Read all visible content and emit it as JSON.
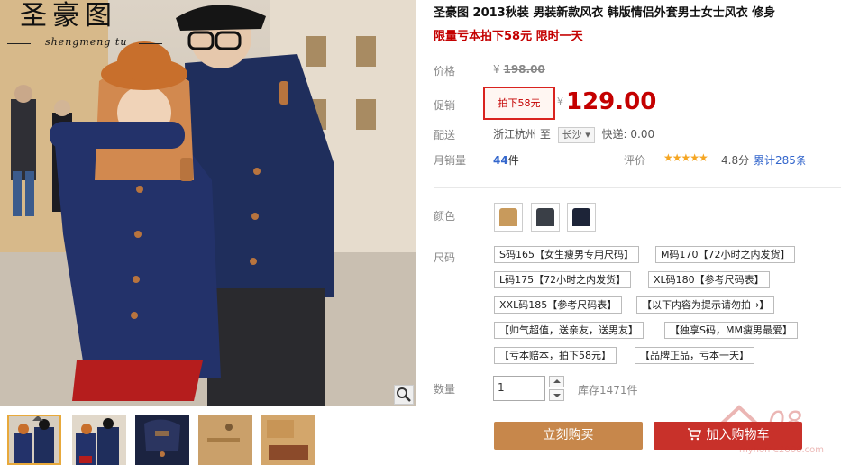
{
  "gallery": {
    "logo_cn": "圣豪图",
    "logo_en": "shengmeng tu",
    "zoom_icon": "magnifier-icon",
    "thumbnails": [
      "couple-front",
      "couple-side",
      "coat-detail-hood",
      "coat-detail-tan",
      "coat-detail-pocket"
    ]
  },
  "product": {
    "title": "圣豪图 2013秋装 男装新款风衣 韩版情侣外套男士女士风衣 修身",
    "promo_line": "限量亏本拍下58元 限时一天"
  },
  "price": {
    "label": "价格",
    "original_currency": "¥",
    "original": "198.00",
    "promo_label": "促销",
    "promo_badge": "拍下58元",
    "currency": "¥",
    "current": "129.00"
  },
  "shipping": {
    "label": "配送",
    "from": "浙江杭州",
    "to_word": "至",
    "city": "长沙",
    "fee": "快递: 0.00"
  },
  "sales": {
    "label": "月销量",
    "count": "44",
    "unit": "件",
    "rating_label": "评价",
    "stars": "★★★★★",
    "score": "4.8分",
    "reviews": "累计285条"
  },
  "options": {
    "color_label": "颜色",
    "colors": [
      "#c89a5c",
      "#3a3f47",
      "#1d2438"
    ],
    "size_label": "尺码",
    "sizes": [
      "S码165【女生瘦男专用尺码】",
      "M码170【72小时之内发货】",
      "L码175【72小时之内发货】",
      "XL码180【参考尺码表】",
      "XXL码185【参考尺码表】",
      "【以下内容为提示请勿拍→】",
      "【帅气超值，送亲友，送男友】",
      "【独享S码，MM瘦男最爱】",
      "【亏本赔本，拍下58元】",
      "【品牌正品，亏本一天】"
    ]
  },
  "quantity": {
    "label": "数量",
    "value": "1",
    "stock": "库存1471件"
  },
  "actions": {
    "buy": "立刻购买",
    "cart": "加入购物车",
    "cart_icon": "cart-icon"
  },
  "watermark": {
    "mark": "08",
    "site": "myhome2008.com"
  },
  "colors": {
    "accent_red": "#c40000",
    "buy_brown": "#c7874b",
    "cart_red": "#c8312a",
    "link_blue": "#3366cc"
  }
}
